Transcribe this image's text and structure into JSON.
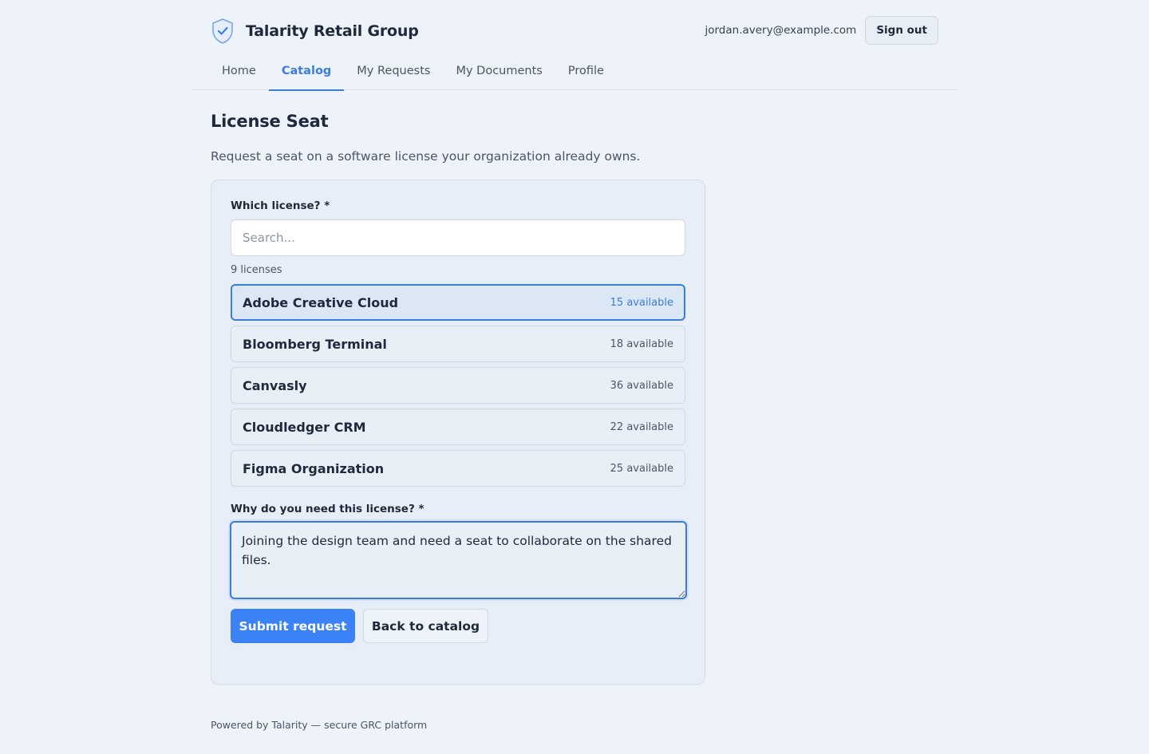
{
  "header": {
    "brand_name": "Talarity Retail Group",
    "brand_icon": "shield-check-icon",
    "user_email": "jordan.avery@example.com",
    "signout_label": "Sign out"
  },
  "nav": {
    "tabs": [
      {
        "label": "Home",
        "active": false
      },
      {
        "label": "Catalog",
        "active": true
      },
      {
        "label": "My Requests",
        "active": false
      },
      {
        "label": "My Documents",
        "active": false
      },
      {
        "label": "Profile",
        "active": false
      }
    ]
  },
  "page": {
    "title": "License Seat",
    "description": "Request a seat on a software license your organization already owns."
  },
  "form": {
    "license_label": "Which license? *",
    "search_placeholder": "Search...",
    "search_value": "",
    "count_text": "9 licenses",
    "licenses": [
      {
        "name": "Adobe Creative Cloud",
        "available": "15 available",
        "selected": true
      },
      {
        "name": "Bloomberg Terminal",
        "available": "18 available",
        "selected": false
      },
      {
        "name": "Canvasly",
        "available": "36 available",
        "selected": false
      },
      {
        "name": "Cloudledger CRM",
        "available": "22 available",
        "selected": false
      },
      {
        "name": "Figma Organization",
        "available": "25 available",
        "selected": false
      }
    ],
    "reason_label": "Why do you need this license? *",
    "reason_value": "Joining the design team and need a seat to collaborate on the shared files.",
    "submit_label": "Submit request",
    "back_label": "Back to catalog"
  },
  "footer": {
    "text": "Powered by Talarity — secure GRC platform"
  },
  "colors": {
    "accent": "#3b7ddd",
    "primary_button": "#3b82f6",
    "background": "#eef3fa"
  }
}
